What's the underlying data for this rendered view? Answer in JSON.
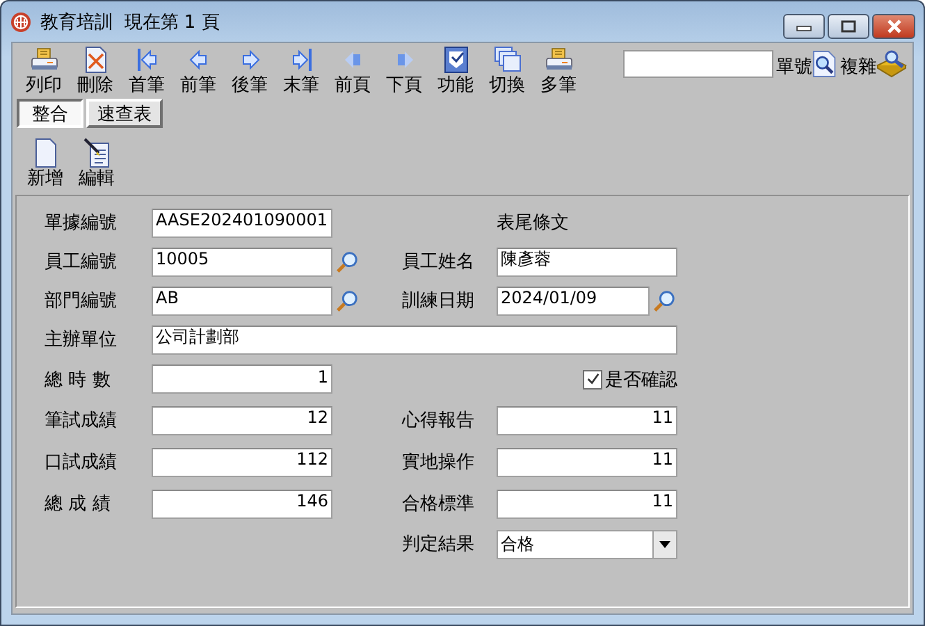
{
  "window": {
    "title": "教育培訓  現在第 1 頁"
  },
  "toolbar": [
    {
      "kind": "print",
      "label": "列印"
    },
    {
      "kind": "delete",
      "label": "刪除"
    },
    {
      "kind": "first",
      "label": "首筆"
    },
    {
      "kind": "prev",
      "label": "前筆"
    },
    {
      "kind": "next",
      "label": "後筆"
    },
    {
      "kind": "last",
      "label": "末筆"
    },
    {
      "kind": "prev_page",
      "label": "前頁"
    },
    {
      "kind": "next_page",
      "label": "下頁"
    },
    {
      "kind": "function",
      "label": "功能"
    },
    {
      "kind": "switch",
      "label": "切換"
    },
    {
      "kind": "print",
      "label": "多筆"
    }
  ],
  "search": {
    "label": "單號",
    "advanced_label": "複雜"
  },
  "tabs": [
    {
      "label": "整合",
      "selected": true
    },
    {
      "label": "速查表",
      "selected": false
    }
  ],
  "actions": [
    {
      "kind": "new",
      "label": "新增"
    },
    {
      "kind": "edit",
      "label": "編輯"
    }
  ],
  "form": {
    "doc_no": {
      "label": "單據編號",
      "value": "AASE202401090001"
    },
    "footer_text": "表尾條文",
    "emp_no": {
      "label": "員工編號",
      "value": "10005"
    },
    "emp_name": {
      "label": "員工姓名",
      "value": "陳彥蓉"
    },
    "dept_no": {
      "label": "部門編號",
      "value": "AB"
    },
    "train_date": {
      "label": "訓練日期",
      "value": "2024/01/09"
    },
    "organizer": {
      "label": "主辦單位",
      "value": "公司計劃部"
    },
    "hours": {
      "label": "總 時 數",
      "value": "1"
    },
    "confirmed": {
      "label": "是否確認",
      "checked": true
    },
    "written": {
      "label": "筆試成績",
      "value": "12"
    },
    "report": {
      "label": "心得報告",
      "value": "11"
    },
    "oral": {
      "label": "口試成績",
      "value": "112"
    },
    "practice": {
      "label": "實地操作",
      "value": "11"
    },
    "total": {
      "label": "總 成 績",
      "value": "146"
    },
    "pass_mark": {
      "label": "合格標準",
      "value": "11"
    },
    "result": {
      "label": "判定結果",
      "value": "合格"
    }
  }
}
